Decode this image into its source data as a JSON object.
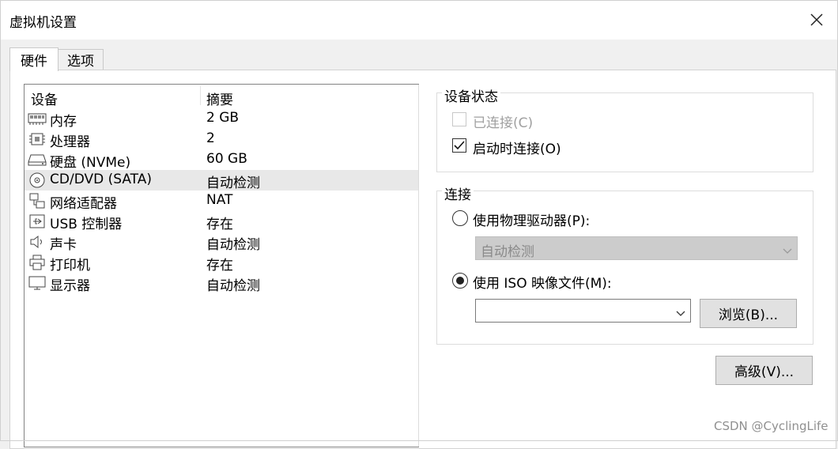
{
  "window": {
    "title": "虚拟机设置"
  },
  "tabs": [
    {
      "label": "硬件",
      "active": true
    },
    {
      "label": "选项",
      "active": false
    }
  ],
  "device_list": {
    "columns": [
      "设备",
      "摘要"
    ],
    "rows": [
      {
        "device": "内存",
        "summary": "2 GB",
        "icon": "memory-icon"
      },
      {
        "device": "处理器",
        "summary": "2",
        "icon": "cpu-icon"
      },
      {
        "device": "硬盘 (NVMe)",
        "summary": "60 GB",
        "icon": "hard-disk-icon"
      },
      {
        "device": "CD/DVD (SATA)",
        "summary": "自动检测",
        "icon": "cd-dvd-icon",
        "selected": true
      },
      {
        "device": "网络适配器",
        "summary": "NAT",
        "icon": "network-adapter-icon"
      },
      {
        "device": "USB 控制器",
        "summary": "存在",
        "icon": "usb-icon"
      },
      {
        "device": "声卡",
        "summary": "自动检测",
        "icon": "speaker-icon"
      },
      {
        "device": "打印机",
        "summary": "存在",
        "icon": "printer-icon"
      },
      {
        "device": "显示器",
        "summary": "自动检测",
        "icon": "monitor-icon"
      }
    ]
  },
  "device_status": {
    "title": "设备状态",
    "connected": {
      "label": "已连接(C)",
      "checked": false,
      "disabled": true
    },
    "connect_on_start": {
      "label": "启动时连接(O)",
      "checked": true
    }
  },
  "connection": {
    "title": "连接",
    "physical_drive": {
      "label": "使用物理驱动器(P):",
      "selected": false,
      "dropdown_value": "自动检测"
    },
    "iso_image": {
      "label": "使用 ISO 映像文件(M):",
      "selected": true,
      "path_value": "",
      "browse_label": "浏览(B)..."
    }
  },
  "advanced_button": "高级(V)...",
  "watermark": "CSDN @CyclingLife"
}
